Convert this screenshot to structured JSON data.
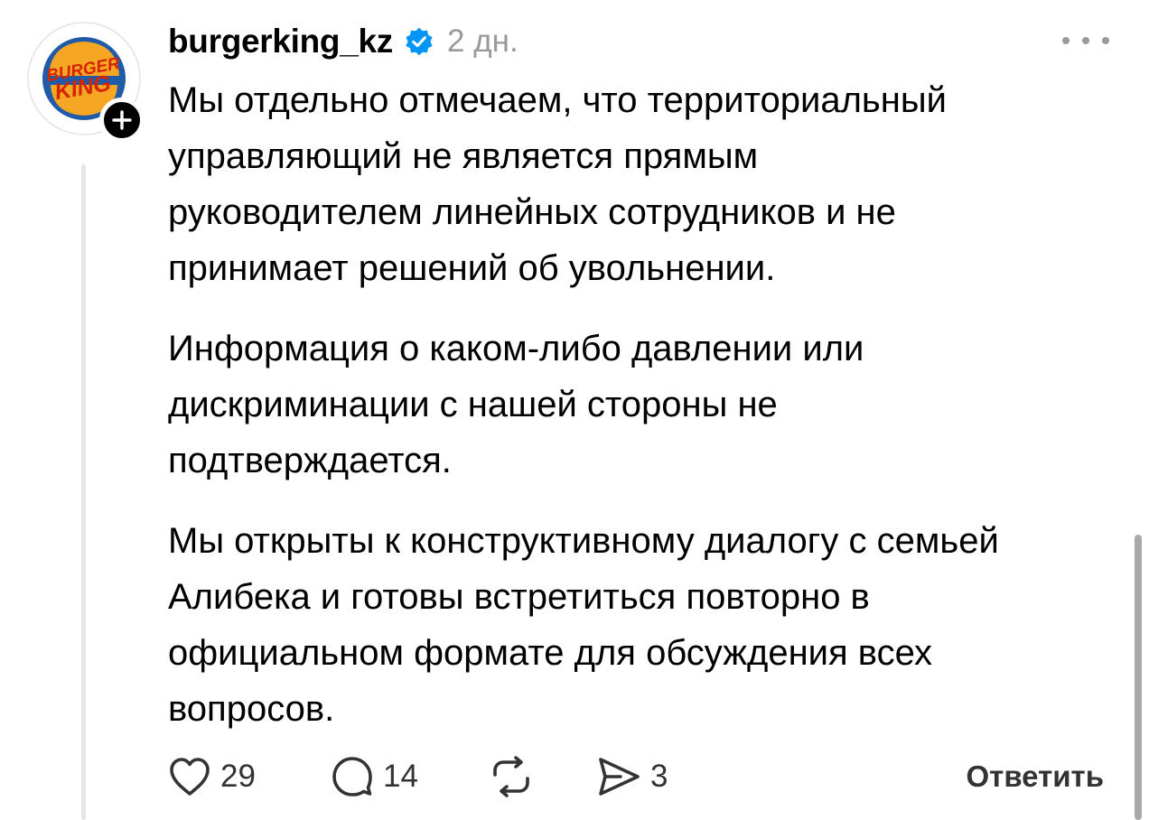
{
  "post": {
    "author": {
      "username": "burgerking_kz",
      "verified": true,
      "avatar_icon": "burger-king-logo",
      "follow_icon": "plus-icon"
    },
    "time": "2 дн.",
    "more_icon": "ellipsis-icon",
    "paragraphs": [
      "Мы отдельно отмечаем, что территориальный\nуправляющий не является прямым\nруководителем линейных сотрудников и не\nпринимает решений об увольнении.",
      "Информация о каком-либо давлении или\nдискриминации с нашей стороны не\nподтверждается.",
      "Мы открыты к конструктивному диалогу с семьей\nАлибека и готовы встретиться повторно в\nофициальном формате для обсуждения всех\nвопросов."
    ],
    "actions": {
      "like": {
        "icon": "heart-icon",
        "count": "29"
      },
      "comment": {
        "icon": "comment-bubble-icon",
        "count": "14"
      },
      "repost": {
        "icon": "repost-icon"
      },
      "share": {
        "icon": "send-icon",
        "count": "3"
      },
      "reply_label": "Ответить"
    }
  },
  "colors": {
    "verified_blue": "#0095f6",
    "bk_red": "#d62300",
    "bk_orange": "#f5a623",
    "bk_blue": "#1f5ba8",
    "secondary_text": "#999999",
    "thread_line": "#e5e5e5"
  }
}
